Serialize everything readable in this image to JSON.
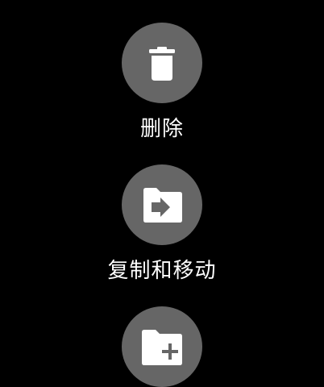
{
  "theme": {
    "background": "#000000",
    "button_fill": "#666666",
    "icon_color": "#ffffff",
    "label_color": "#ffffff"
  },
  "actions": [
    {
      "id": "delete",
      "label": "删除",
      "icon": "trash-icon"
    },
    {
      "id": "copy-move",
      "label": "复制和移动",
      "icon": "folder-move-icon"
    },
    {
      "id": "new-folder",
      "label": "",
      "icon": "folder-add-icon"
    }
  ]
}
